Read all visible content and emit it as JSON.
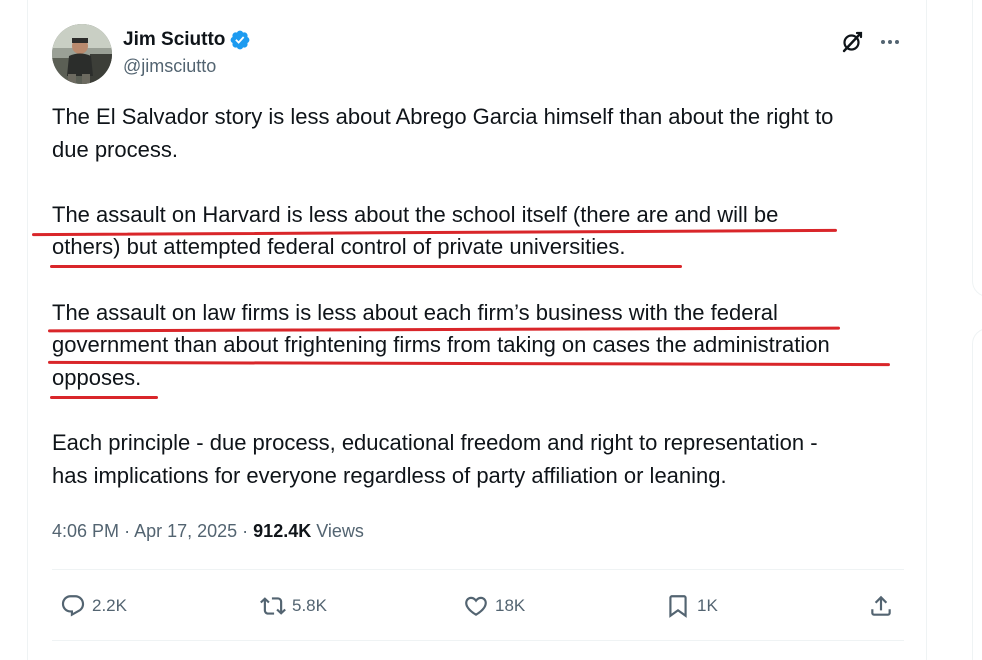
{
  "author": {
    "name": "Jim Sciutto",
    "handle": "@jimsciutto"
  },
  "tweet": {
    "paragraphs": [
      [
        "The El Salvador story is less about Abrego Garcia himself than about the right to",
        "due process."
      ],
      [
        "The assault on Harvard is less about the school itself (there are and will be",
        "others) but attempted federal control of private universities."
      ],
      [
        "The assault on law firms is less about each firm’s business with the federal",
        "government than about frightening firms from taking on cases the administration",
        "opposes."
      ],
      [
        "Each principle - due process, educational freedom and right to representation -",
        "has implications for everyone regardless of party affiliation or leaning."
      ]
    ]
  },
  "meta": {
    "time": "4:06 PM",
    "date": "Apr 17, 2025",
    "views_count": "912.4K",
    "views_label": "Views"
  },
  "actions": {
    "replies": "2.2K",
    "reposts": "5.8K",
    "likes": "18K",
    "bookmarks": "1K"
  },
  "colors": {
    "verified": "#1d9bf0",
    "underline_annotation": "#d9262a",
    "secondary_text": "#536471"
  }
}
